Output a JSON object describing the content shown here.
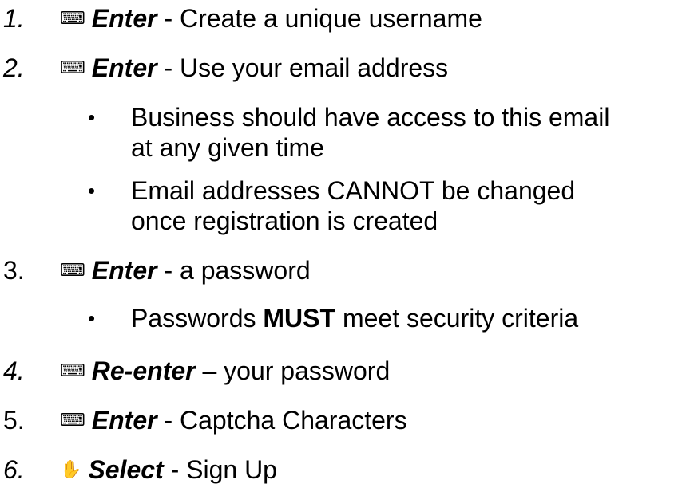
{
  "steps": [
    {
      "number": "1.",
      "icon": "keyboard-icon",
      "icon_glyph": "⌨",
      "verb": "Enter",
      "rest": " - Create a unique username"
    },
    {
      "number": "2.",
      "icon": "keyboard-icon",
      "icon_glyph": "⌨",
      "verb": "Enter",
      "rest": " - Use your email address",
      "bullets": [
        {
          "line1": "Business should have access to this email",
          "line2": "at any given time"
        },
        {
          "line1": "Email addresses CANNOT be changed",
          "line2": "once registration is created"
        }
      ]
    },
    {
      "number": "3.",
      "icon": "keyboard-icon",
      "icon_glyph": "⌨",
      "verb": "Enter",
      "rest": " - a password",
      "bullets": [
        {
          "pre": "Passwords ",
          "strong": "MUST",
          "post": " meet security criteria"
        }
      ]
    },
    {
      "number": "4.",
      "icon": "keyboard-icon",
      "icon_glyph": "⌨",
      "verb": "Re-enter",
      "rest": " – your password"
    },
    {
      "number": "5.",
      "icon": "keyboard-icon",
      "icon_glyph": "⌨",
      "verb": "Enter",
      "rest": " - Captcha Characters"
    },
    {
      "number": "6.",
      "icon": "mouse-pointer-icon",
      "icon_glyph": "✋",
      "verb": "Select",
      "rest": " - Sign Up"
    }
  ],
  "bullet_glyph": "•"
}
